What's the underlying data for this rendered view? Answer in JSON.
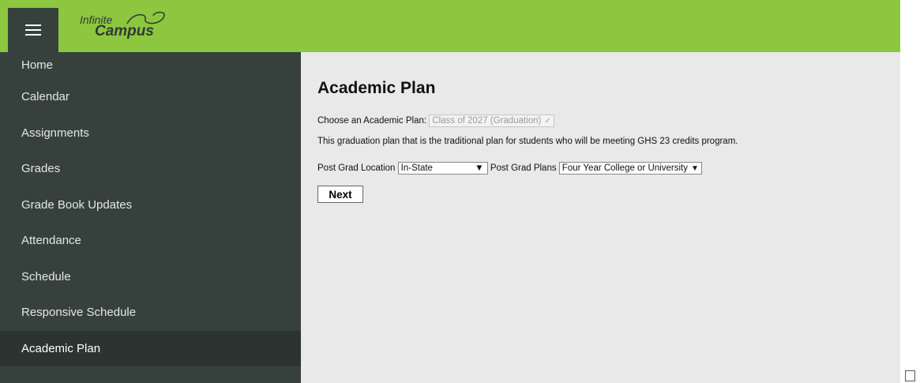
{
  "header": {
    "logo_line1": "Infinite",
    "logo_line2": "Campus",
    "menu_icon": "hamburger-icon"
  },
  "sidebar": {
    "items": [
      {
        "label": "Home"
      },
      {
        "label": "Calendar"
      },
      {
        "label": "Assignments"
      },
      {
        "label": "Grades"
      },
      {
        "label": "Grade Book Updates"
      },
      {
        "label": "Attendance"
      },
      {
        "label": "Schedule"
      },
      {
        "label": "Responsive Schedule"
      },
      {
        "label": "Academic Plan",
        "active": true
      }
    ]
  },
  "main": {
    "title": "Academic Plan",
    "choose_label": "Choose an Academic Plan:",
    "choose_value": "Class of 2027 (Graduation)",
    "description": "This graduation plan that is the traditional plan for students who will be meeting GHS 23 credits program.",
    "location_label": "Post Grad Location",
    "location_value": "In-State",
    "plans_label": "Post Grad Plans",
    "plans_value": "Four Year College or University",
    "next_label": "Next"
  },
  "colors": {
    "topbar": "#8dc63f",
    "sidebar": "#36413e",
    "main_bg": "#e9e9e9"
  }
}
